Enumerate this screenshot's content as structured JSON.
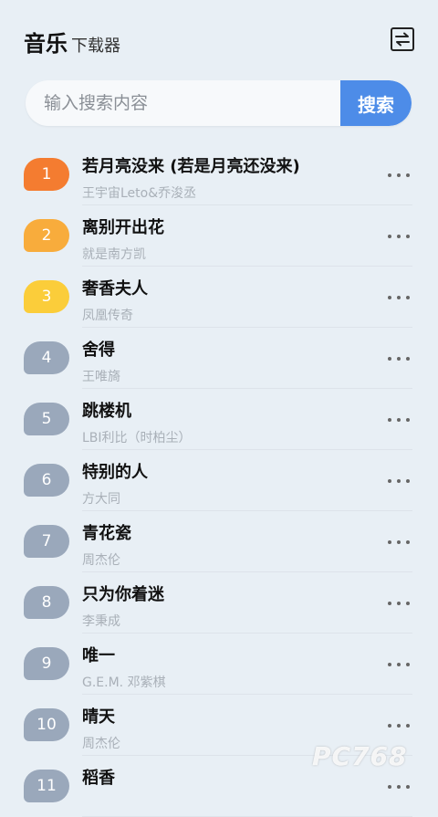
{
  "header": {
    "title": "音乐",
    "subtitle": "下载器"
  },
  "search": {
    "placeholder": "输入搜索内容",
    "button_label": "搜索"
  },
  "songs": [
    {
      "rank": "1",
      "title": "若月亮没来 (若是月亮还没来)",
      "artist": "王宇宙Leto&乔浚丞",
      "color": "#f47c30"
    },
    {
      "rank": "2",
      "title": "离别开出花",
      "artist": "就是南方凯",
      "color": "#f8ac3c"
    },
    {
      "rank": "3",
      "title": "奢香夫人",
      "artist": "凤凰传奇",
      "color": "#fbcd3a"
    },
    {
      "rank": "4",
      "title": "舍得",
      "artist": "王唯旖",
      "color": "#9aa8bb"
    },
    {
      "rank": "5",
      "title": "跳楼机",
      "artist": "LBI利比（时柏尘）",
      "color": "#9aa8bb"
    },
    {
      "rank": "6",
      "title": "特别的人",
      "artist": "方大同",
      "color": "#9aa8bb"
    },
    {
      "rank": "7",
      "title": "青花瓷",
      "artist": "周杰伦",
      "color": "#9aa8bb"
    },
    {
      "rank": "8",
      "title": "只为你着迷",
      "artist": "李秉成",
      "color": "#9aa8bb"
    },
    {
      "rank": "9",
      "title": "唯一",
      "artist": "G.E.M. 邓紫棋",
      "color": "#9aa8bb"
    },
    {
      "rank": "10",
      "title": "晴天",
      "artist": "周杰伦",
      "color": "#9aa8bb"
    },
    {
      "rank": "11",
      "title": "稻香",
      "artist": "",
      "color": "#9aa8bb"
    }
  ],
  "watermark": "PC768"
}
